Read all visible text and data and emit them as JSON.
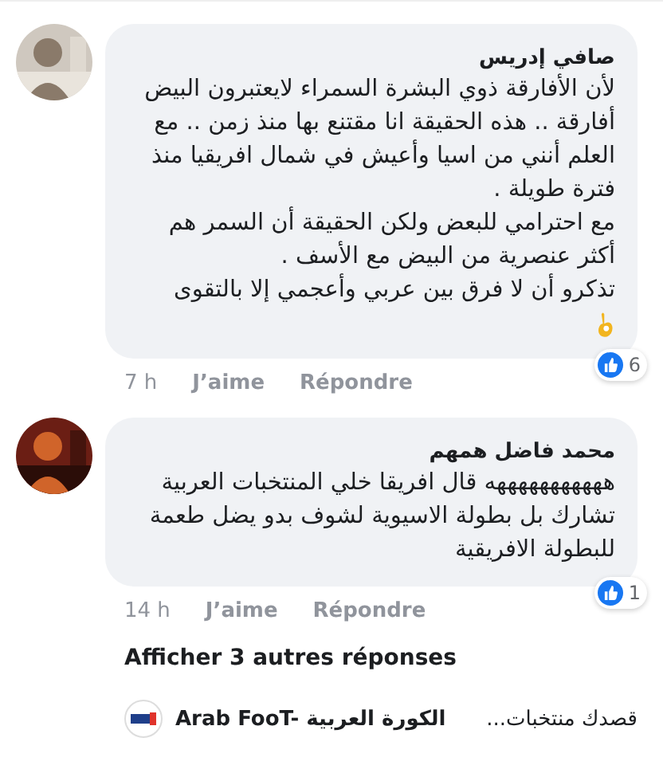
{
  "comments": [
    {
      "author": "صافي إدريس",
      "paragraphs": [
        "لأن الأفارقة ذوي البشرة السمراء لايعتبرون البيض أفارقة .. هذه الحقيقة انا مقتنع بها منذ زمن .. مع العلم أنني من اسيا وأعيش في شمال افريقيا منذ فترة طويلة .",
        "مع احترامي للبعض ولكن الحقيقة أن السمر هم أكثر عنصرية من البيض مع الأسف .",
        "تذكرو أن لا فرق بين عربي وأعجمي إلا بالتقوى"
      ],
      "ok_hand": true,
      "time": "7 h",
      "like": "J’aime",
      "reply": "Répondre",
      "reactions": "6"
    },
    {
      "author": "محمد فاضل همهم",
      "paragraphs": [
        "هههههههههههه قال افريقا خلي المنتخبات العربية تشارك بل بطولة الاسيوية لشوف بدو يضل طعمة للبطولة الافريقية"
      ],
      "ok_hand": false,
      "time": "14 h",
      "like": "J’aime",
      "reply": "Répondre",
      "reactions": "1"
    }
  ],
  "more_replies": "Afficher 3 autres réponses",
  "reply_preview": {
    "author": "Arab FooT- الكورة العربية",
    "text": "قصدك منتخبات..."
  }
}
